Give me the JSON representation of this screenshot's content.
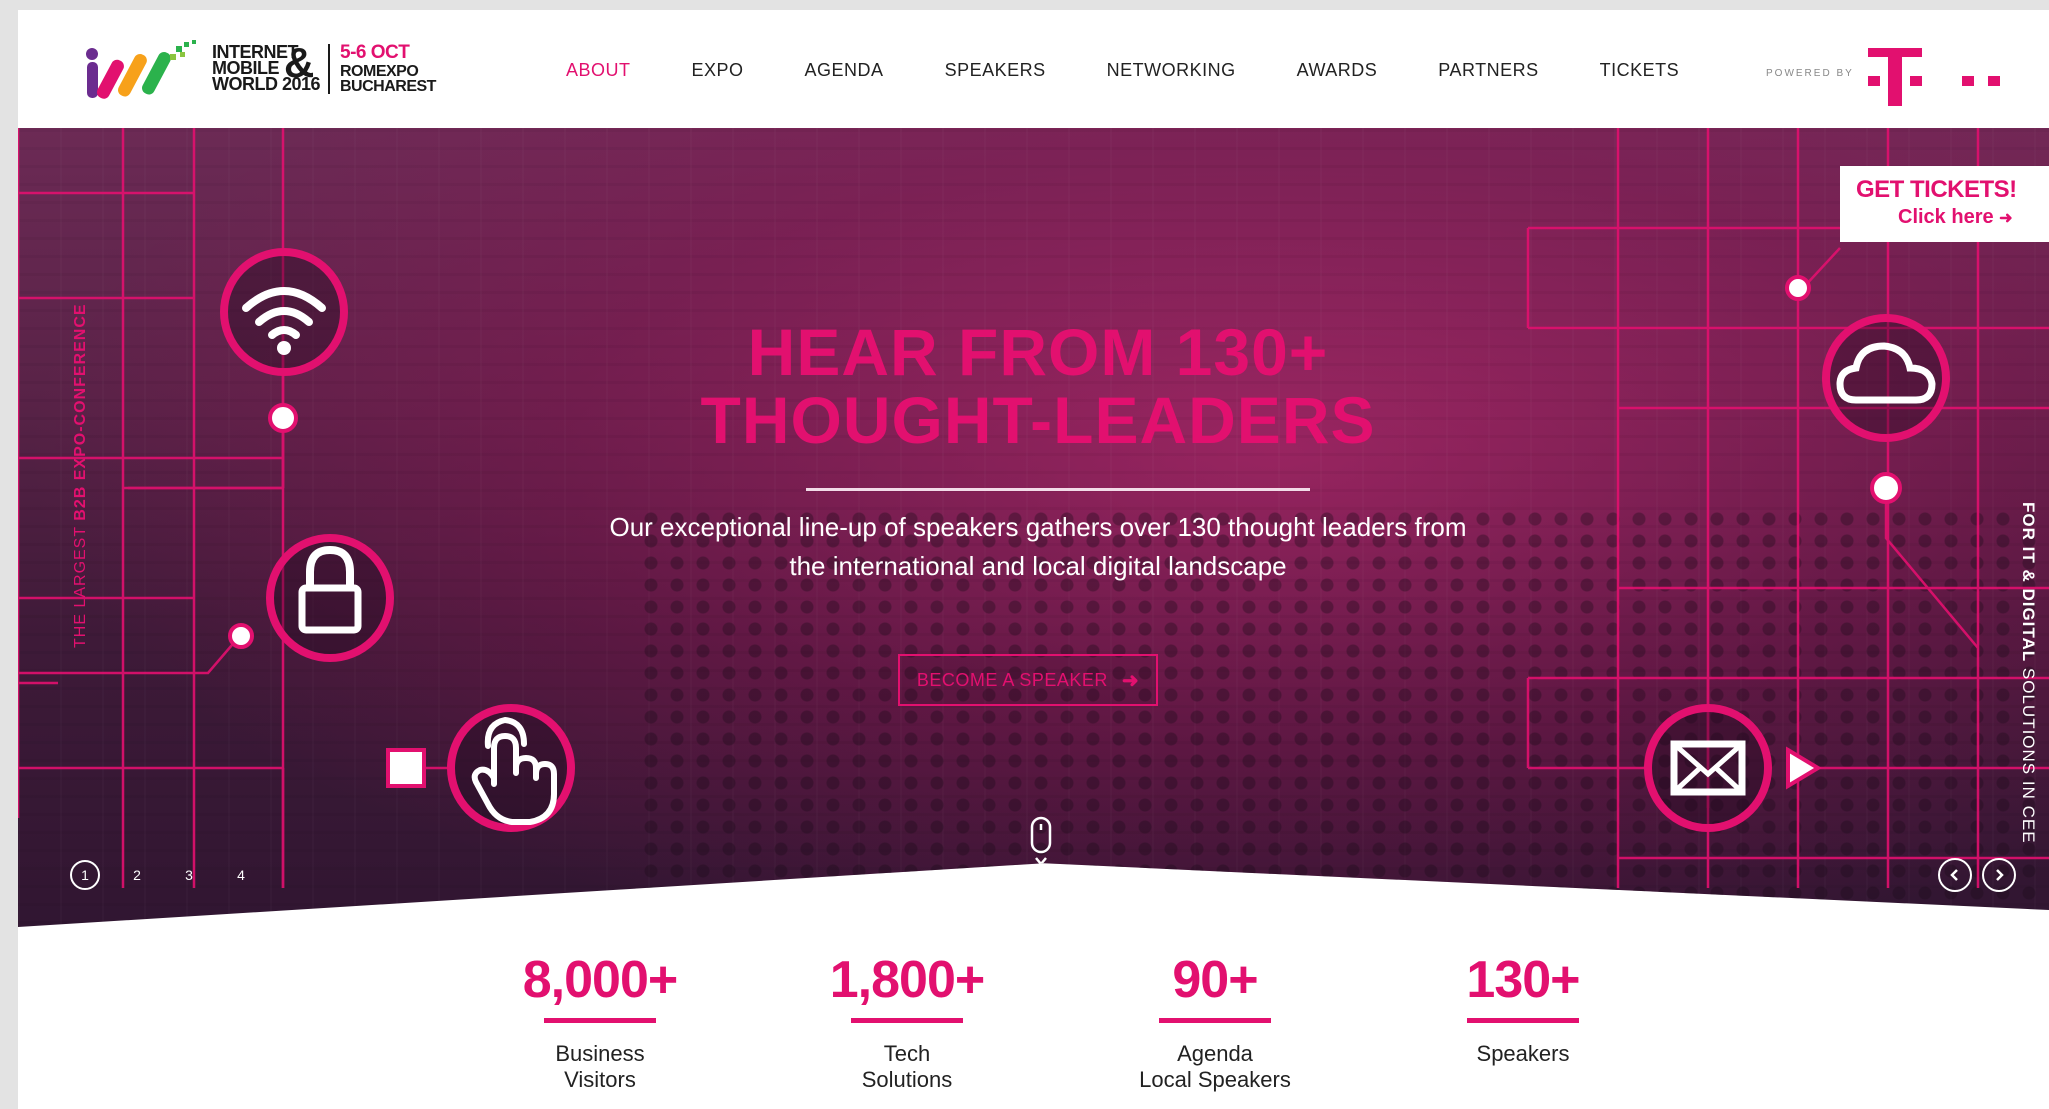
{
  "header": {
    "logo": {
      "name_lines": [
        "INTERNET",
        "MOBILE",
        "WORLD 2016"
      ],
      "amp": "&",
      "date": "5-6 OCT",
      "venue_lines": [
        "ROMEXPO",
        "BUCHAREST"
      ]
    },
    "nav": [
      {
        "label": "ABOUT",
        "active": true
      },
      {
        "label": "EXPO",
        "active": false
      },
      {
        "label": "AGENDA",
        "active": false
      },
      {
        "label": "SPEAKERS",
        "active": false
      },
      {
        "label": "NETWORKING",
        "active": false
      },
      {
        "label": "AWARDS",
        "active": false
      },
      {
        "label": "PARTNERS",
        "active": false
      },
      {
        "label": "TICKETS",
        "active": false
      }
    ],
    "powered_by": "POWERED BY",
    "sponsor_logo": "T"
  },
  "hero": {
    "title_line1": "HEAR FROM 130+",
    "title_line2": "THOUGHT-LEADERS",
    "description_line1": "Our exceptional line-up of speakers gathers over 130 thought leaders from",
    "description_line2": "the international and local digital landscape",
    "cta_label": "BECOME A SPEAKER",
    "side_left_prefix": "THE LARGEST ",
    "side_left_bold": "B2B EXPO-CONFERENCE",
    "side_right_bold": "FOR IT & DIGITAL",
    "side_right_rest": " SOLUTIONS IN CEE",
    "tickets_title": "GET TICKETS!",
    "tickets_sub": "Click here",
    "slides": [
      "1",
      "2",
      "3",
      "4"
    ],
    "active_slide": 1,
    "icons": [
      "wifi-icon",
      "lock-icon",
      "touch-icon",
      "cloud-icon",
      "mail-icon",
      "play-icon"
    ]
  },
  "stats": [
    {
      "value": "8,000+",
      "label_lines": [
        "Business",
        "Visitors"
      ]
    },
    {
      "value": "1,800+",
      "label_lines": [
        "Tech",
        "Solutions"
      ]
    },
    {
      "value": "90+",
      "label_lines": [
        "Agenda",
        "Local Speakers"
      ]
    },
    {
      "value": "130+",
      "label_lines": [
        "Speakers"
      ]
    }
  ],
  "colors": {
    "accent": "#e2106f",
    "hero_dark": "#3e1a38",
    "text": "#222222"
  }
}
